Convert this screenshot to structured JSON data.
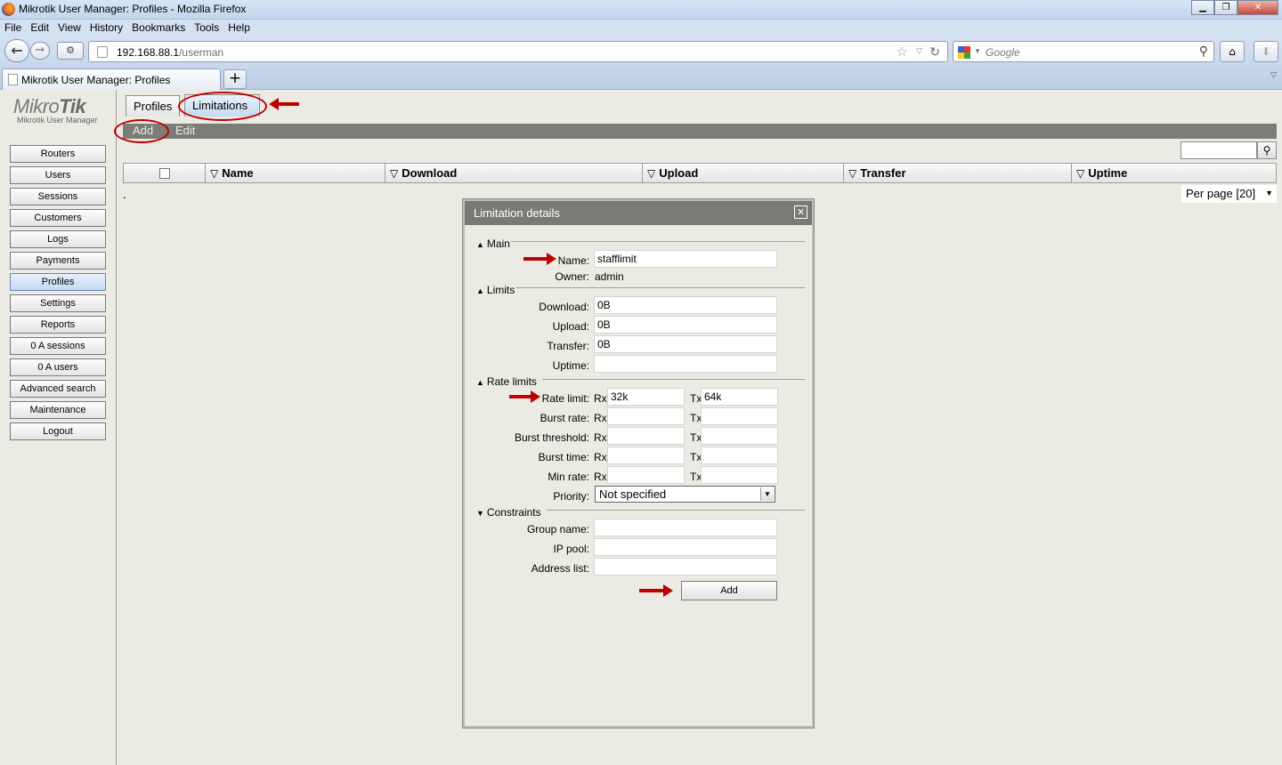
{
  "window": {
    "title": "Mikrotik User Manager: Profiles - Mozilla Firefox"
  },
  "menu": [
    "File",
    "Edit",
    "View",
    "History",
    "Bookmarks",
    "Tools",
    "Help"
  ],
  "address": {
    "host": "192.168.88.1",
    "path": "/userman"
  },
  "search": {
    "placeholder": "Google"
  },
  "browser_tab": {
    "title": "Mikrotik User Manager: Profiles",
    "new_tab": "+"
  },
  "logo": {
    "brand_light": "Mikro",
    "brand_bold": "Tik",
    "subtitle": "Mikrotik User Manager"
  },
  "sidebar": [
    {
      "label": "Routers"
    },
    {
      "label": "Users"
    },
    {
      "label": "Sessions"
    },
    {
      "label": "Customers"
    },
    {
      "label": "Logs"
    },
    {
      "label": "Payments"
    },
    {
      "label": "Profiles",
      "active": true
    },
    {
      "label": "Settings"
    },
    {
      "label": "Reports"
    },
    {
      "label": "0 A sessions"
    },
    {
      "label": "0 A users"
    },
    {
      "label": "Advanced search"
    },
    {
      "label": "Maintenance"
    },
    {
      "label": "Logout"
    }
  ],
  "tabs": {
    "profiles": "Profiles",
    "limitations": "Limitations"
  },
  "actions": {
    "add": "Add",
    "edit": "Edit"
  },
  "table": {
    "columns": [
      "Name",
      "Download",
      "Upload",
      "Transfer",
      "Uptime"
    ],
    "sort_glyph": "▽",
    "empty_marker": ".",
    "per_page": "Per page [20]"
  },
  "dialog": {
    "title": "Limitation details",
    "close": "✕",
    "sections": {
      "main": "Main",
      "limits": "Limits",
      "rate_limits": "Rate limits",
      "constraints": "Constraints"
    },
    "labels": {
      "name": "Name:",
      "owner": "Owner:",
      "download": "Download:",
      "upload": "Upload:",
      "transfer": "Transfer:",
      "uptime": "Uptime:",
      "rate_limit": "Rate limit:",
      "burst_rate": "Burst rate:",
      "burst_threshold": "Burst threshold:",
      "burst_time": "Burst time:",
      "min_rate": "Min rate:",
      "priority": "Priority:",
      "group_name": "Group name:",
      "ip_pool": "IP pool:",
      "address_list": "Address list:",
      "rx": "Rx",
      "tx": "Tx"
    },
    "values": {
      "name": "stafflimit",
      "owner": "admin",
      "download": "0B",
      "upload": "0B",
      "transfer": "0B",
      "uptime": "",
      "rate_limit_rx": "32k",
      "rate_limit_tx": "64k",
      "burst_rate_rx": "",
      "burst_rate_tx": "",
      "burst_threshold_rx": "",
      "burst_threshold_tx": "",
      "burst_time_rx": "",
      "burst_time_tx": "",
      "min_rate_rx": "",
      "min_rate_tx": "",
      "priority": "Not specified",
      "group_name": "",
      "ip_pool": "",
      "address_list": ""
    },
    "submit": "Add"
  },
  "colors": {
    "annotation": "#c00000",
    "dark_bar": "#7d7d78",
    "dialog_title": "#7a7a74"
  }
}
